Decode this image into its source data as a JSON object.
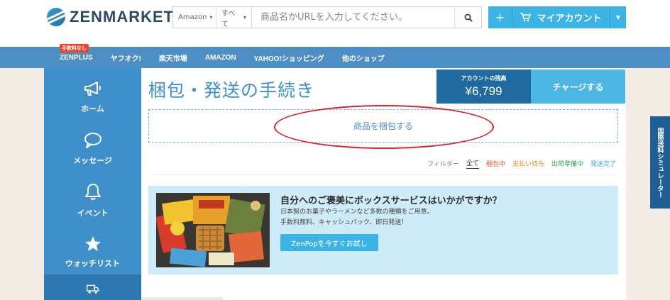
{
  "header": {
    "logo_text": "ZENMARKET",
    "search": {
      "source_select": "Amazon",
      "category_select": "すべて",
      "placeholder": "商品名かURLを入力してください。"
    },
    "account_button_label": "マイアカウント"
  },
  "nav": {
    "items": [
      {
        "label": "ZENPLUS",
        "badge": "手数料なし"
      },
      {
        "label": "ヤフオク!"
      },
      {
        "label": "楽天市場"
      },
      {
        "label": "AMAZON"
      },
      {
        "label": "YAHOO!ショッピング"
      },
      {
        "label": "他のショップ"
      }
    ]
  },
  "sidebar": {
    "items": [
      {
        "label": "ホーム",
        "icon": "megaphone-icon"
      },
      {
        "label": "メッセージ",
        "icon": "chat-bubble-icon"
      },
      {
        "label": "イベント",
        "icon": "bell-icon"
      },
      {
        "label": "ウォッチリスト",
        "icon": "star-icon"
      },
      {
        "label": "",
        "icon": "truck-icon"
      }
    ]
  },
  "main": {
    "title": "梱包・発送の手続き",
    "balance": {
      "label": "アカウントの残高",
      "value": "¥6,799"
    },
    "charge_label": "チャージする",
    "pack_label": "商品を梱包する",
    "filters": {
      "label": "フィルター",
      "all": "全て",
      "packing": "梱包中",
      "payment": "支払い待ち",
      "shipping_prep": "出荷準備中",
      "shipped": "発送完了"
    },
    "promo": {
      "title": "自分へのご褒美にボックスサービスはいかがですか？",
      "line1": "日本製のお菓子やラーメンなど多数の種類をご用意。",
      "line2": "手数料無料、キャッシュバック、即日発送！",
      "button": "ZenPopを今すぐお試し"
    }
  },
  "side_tab_label": "国際送料シミュレーター",
  "colors": {
    "nav_blue": "#4d8fc4",
    "sidebar_blue": "#3f8fcb",
    "accent_light_blue": "#3bb4e5",
    "balance_dark_blue": "#1f6aa0",
    "highlight_red": "#d9202a"
  }
}
